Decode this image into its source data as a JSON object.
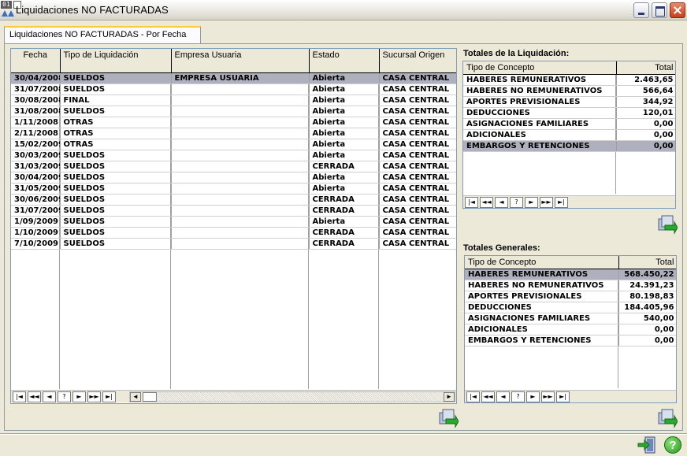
{
  "window": {
    "title": "Liquidaciones NO FACTURADAS",
    "icon_text": "01"
  },
  "tab": {
    "label": "Liquidaciones NO FACTURADAS - Por Fecha"
  },
  "main_grid": {
    "columns": [
      "Fecha",
      "Tipo de Liquidación",
      "Empresa Usuaria",
      "Estado",
      "Sucursal Origen"
    ],
    "rows": [
      [
        "30/04/2008",
        "SUELDOS",
        "EMPRESA USUARIA",
        "Abierta",
        "CASA CENTRAL"
      ],
      [
        "31/07/2008",
        "SUELDOS",
        "",
        "Abierta",
        "CASA CENTRAL"
      ],
      [
        "30/08/2008",
        "FINAL",
        "",
        "Abierta",
        "CASA CENTRAL"
      ],
      [
        "31/08/2008",
        "SUELDOS",
        "",
        "Abierta",
        "CASA CENTRAL"
      ],
      [
        "1/11/2008",
        "OTRAS",
        "",
        "Abierta",
        "CASA CENTRAL"
      ],
      [
        "2/11/2008",
        "OTRAS",
        "",
        "Abierta",
        "CASA CENTRAL"
      ],
      [
        "15/02/2009",
        "OTRAS",
        "",
        "Abierta",
        "CASA CENTRAL"
      ],
      [
        "30/03/2009",
        "SUELDOS",
        "",
        "Abierta",
        "CASA CENTRAL"
      ],
      [
        "31/03/2009",
        "SUELDOS",
        "",
        "CERRADA",
        "CASA CENTRAL"
      ],
      [
        "30/04/2009",
        "SUELDOS",
        "",
        "Abierta",
        "CASA CENTRAL"
      ],
      [
        "31/05/2009",
        "SUELDOS",
        "",
        "Abierta",
        "CASA CENTRAL"
      ],
      [
        "30/06/2009",
        "SUELDOS",
        "",
        "CERRADA",
        "CASA CENTRAL"
      ],
      [
        "31/07/2009",
        "SUELDOS",
        "",
        "CERRADA",
        "CASA CENTRAL"
      ],
      [
        "1/09/2009",
        "SUELDOS",
        "",
        "Abierta",
        "CASA CENTRAL"
      ],
      [
        "1/10/2009",
        "SUELDOS",
        "",
        "CERRADA",
        "CASA CENTRAL"
      ],
      [
        "7/10/2009",
        "SUELDOS",
        "",
        "CERRADA",
        "CASA CENTRAL"
      ]
    ]
  },
  "totales_liquidacion": {
    "label": "Totales de la Liquidación:",
    "columns": [
      "Tipo de Concepto",
      "Total"
    ],
    "rows": [
      [
        "HABERES REMUNERATIVOS",
        "2.463,65"
      ],
      [
        "HABERES NO REMUNERATIVOS",
        "566,64"
      ],
      [
        "APORTES PREVISIONALES",
        "344,92"
      ],
      [
        "DEDUCCIONES",
        "120,01"
      ],
      [
        "ASIGNACIONES FAMILIARES",
        "0,00"
      ],
      [
        "ADICIONALES",
        "0,00"
      ],
      [
        "EMBARGOS Y RETENCIONES",
        "0,00"
      ]
    ]
  },
  "totales_generales": {
    "label": "Totales Generales:",
    "columns": [
      "Tipo de Concepto",
      "Total"
    ],
    "rows": [
      [
        "HABERES REMUNERATIVOS",
        "568.450,22"
      ],
      [
        "HABERES NO REMUNERATIVOS",
        "24.391,23"
      ],
      [
        "APORTES PREVISIONALES",
        "80.198,83"
      ],
      [
        "DEDUCCIONES",
        "184.405,96"
      ],
      [
        "ASIGNACIONES FAMILIARES",
        "540,00"
      ],
      [
        "ADICIONALES",
        "0,00"
      ],
      [
        "EMBARGOS Y RETENCIONES",
        "0,00"
      ]
    ]
  },
  "navigator": {
    "first": "|◄",
    "prev_page": "◄◄",
    "prev": "◄",
    "search": "?",
    "next": "►",
    "next_page": "►►",
    "last": "►|"
  },
  "icons": {
    "refresh": "refresh-icon",
    "exit": "exit-icon",
    "help": "?"
  },
  "colors": {
    "selection": "#aeb0bd",
    "window_bg": "#ece9d8",
    "tab_accent": "#ffc83c"
  }
}
